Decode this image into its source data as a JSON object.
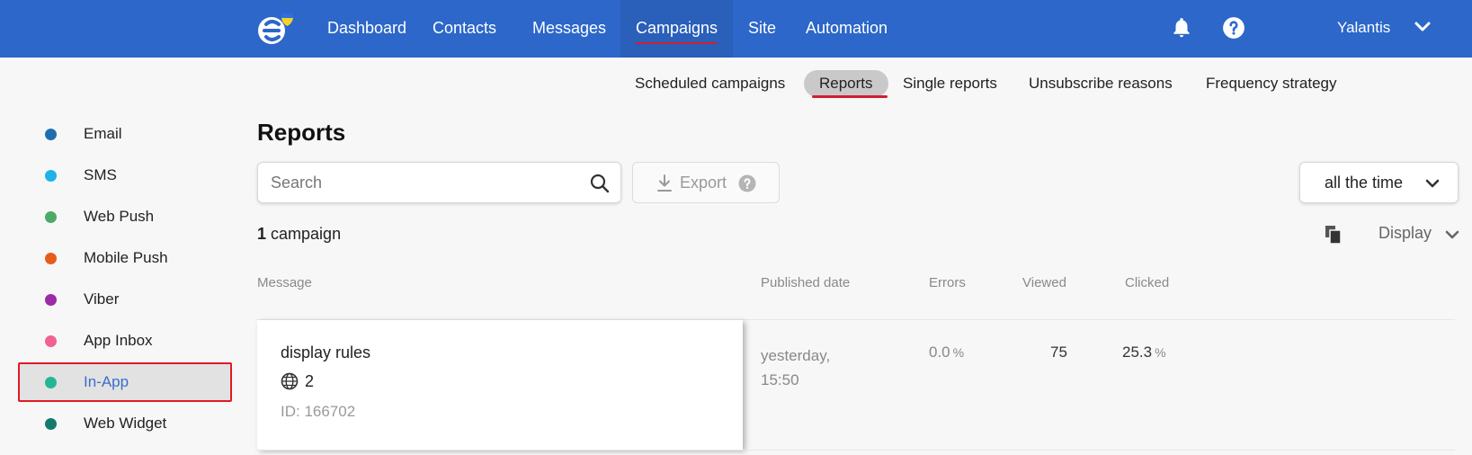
{
  "nav": {
    "items": [
      {
        "label": "Dashboard"
      },
      {
        "label": "Contacts"
      },
      {
        "label": "Messages"
      },
      {
        "label": "Campaigns"
      },
      {
        "label": "Site"
      },
      {
        "label": "Automation"
      }
    ],
    "active": "Campaigns",
    "user": "Yalantis"
  },
  "subnav": {
    "items": [
      {
        "label": "Scheduled campaigns"
      },
      {
        "label": "Reports"
      },
      {
        "label": "Single reports"
      },
      {
        "label": "Unsubscribe reasons"
      },
      {
        "label": "Frequency strategy"
      }
    ],
    "active": "Reports"
  },
  "sidebar": {
    "items": [
      {
        "label": "Email",
        "color": "#1f6fb0"
      },
      {
        "label": "SMS",
        "color": "#1eb3e6"
      },
      {
        "label": "Web Push",
        "color": "#4daa66"
      },
      {
        "label": "Mobile Push",
        "color": "#e85c1b"
      },
      {
        "label": "Viber",
        "color": "#9b2ba6"
      },
      {
        "label": "App Inbox",
        "color": "#f06292"
      },
      {
        "label": "In-App",
        "color": "#26b594"
      },
      {
        "label": "Web Widget",
        "color": "#157a6e"
      }
    ],
    "active": "In-App"
  },
  "main": {
    "title": "Reports",
    "search_placeholder": "Search",
    "export_label": "Export",
    "period_label": "all the time",
    "count_number": "1",
    "count_label": "campaign",
    "display_label": "Display",
    "columns": {
      "message": "Message",
      "published": "Published date",
      "errors": "Errors",
      "viewed": "Viewed",
      "clicked": "Clicked"
    },
    "rows": [
      {
        "name": "display rules",
        "sites": "2",
        "id": "ID: 166702",
        "published_line1": "yesterday,",
        "published_line2": "15:50",
        "errors": "0.0",
        "errors_unit": "%",
        "viewed": "75",
        "clicked": "25.3",
        "clicked_unit": "%"
      }
    ]
  },
  "icons": {
    "logo": "esputnik-logo-icon",
    "bell": "bell-icon",
    "help": "help-icon",
    "search": "search-icon",
    "export": "download-icon",
    "copy": "copy-icon",
    "globe": "globe-icon",
    "chevron": "chevron-down-icon"
  },
  "colors": {
    "topbar": "#2c67c9",
    "accent_red": "#d21f2e",
    "link_blue": "#3a6ec9"
  }
}
